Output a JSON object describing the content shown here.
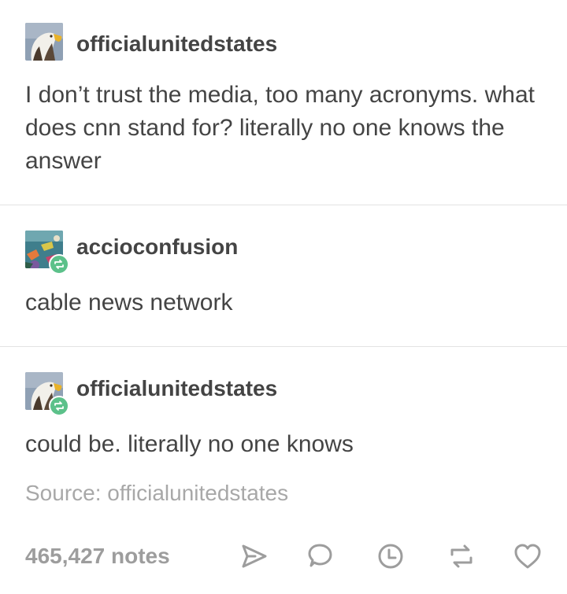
{
  "posts": [
    {
      "username": "officialunitedstates",
      "text": "I don’t trust the media, too many acronyms. what does cnn stand for?  literally no one knows the answer",
      "avatar": "bald-eagle-avatar",
      "reblogged": false
    },
    {
      "username": "accioconfusion",
      "text": "cable news network",
      "avatar": "colorful-fish-avatar",
      "reblogged": true
    },
    {
      "username": "officialunitedstates",
      "text": "could be.  literally no one knows",
      "avatar": "bald-eagle-avatar",
      "reblogged": true
    }
  ],
  "source": "Source: officialunitedstates",
  "footer": {
    "notes": "465,427 notes",
    "actions": [
      "share-icon",
      "reply-icon",
      "queue-clock-icon",
      "reblog-icon",
      "like-heart-icon"
    ]
  },
  "colors": {
    "text": "#444444",
    "muted": "#a8a8a8",
    "reblog_badge": "#5cc18a",
    "icon": "#9d9d9d"
  }
}
